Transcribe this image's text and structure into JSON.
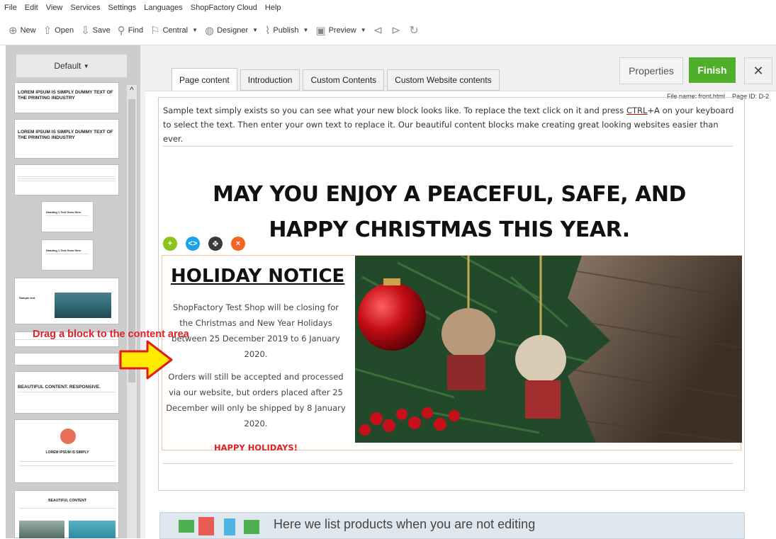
{
  "menubar": {
    "items": [
      "File",
      "Edit",
      "View",
      "Services",
      "Settings",
      "Languages",
      "ShopFactory Cloud",
      "Help"
    ]
  },
  "toolbar": {
    "new": "New",
    "open": "Open",
    "save": "Save",
    "find": "Find",
    "central": "Central",
    "designer": "Designer",
    "publish": "Publish",
    "preview": "Preview"
  },
  "leftpanel": {
    "default_label": "Default",
    "thumb1": "LOREM IPSUM IS SIMPLY DUMMY TEXT OF THE PRINTING INDUSTRY",
    "thumb2": "LOREM IPSUM IS SIMPLY DUMMY TEXT OF THE PRINTING INDUSTRY",
    "thumb3": "Heading 1 Text Goes Here",
    "thumb4": "Heading 1 Text Goes Here",
    "thumb5": "Sample text",
    "thumb6": "BEAUTIFUL CONTENT. RESPONSIVE.",
    "thumb7": "LOREM IPSUM IS SIMPLY",
    "thumb8": "BEAUTIFUL CONTENT"
  },
  "tabs": [
    "Page content",
    "Introduction",
    "Custom Contents",
    "Custom Website contents"
  ],
  "buttons": {
    "properties": "Properties",
    "finish": "Finish",
    "close": "✕"
  },
  "fileinfo": {
    "filename": "File name: front.html",
    "pageid": "Page ID: D-2"
  },
  "content": {
    "sample_before": "Sample text simply exists so you can see what your new block looks like. To replace the text click on it and press ",
    "sample_ctrl": "CTRL",
    "sample_after": "+A on your keyboard to select the text. Then enter your own text to replace it. Our beautiful content blocks make creating great looking websites easier than ever.",
    "headline_line1": "MAY YOU ENJOY A PEACEFUL, SAFE, AND",
    "headline_line2": "HAPPY CHRISTMAS THIS YEAR.",
    "holiday_title": "HOLIDAY NOTICE",
    "holiday_p1": "ShopFactory Test Shop will be closing for the Christmas and New Year Holidays between 25 December 2019 to 6 January 2020.",
    "holiday_p2": "Orders will still be accepted and processed via our website, but orders placed after 25 December will only be shipped by 8 January 2020.",
    "holiday_happy": "HAPPY HOLIDAYS!"
  },
  "block_controls": {
    "add": "+",
    "code": "<>",
    "move": "✥",
    "delete": "×"
  },
  "products_text": "Here we list products when you are not editing",
  "drag_hint": "Drag a block to the content area",
  "colors": {
    "finish": "#4fae2a",
    "drag": "#e0202a",
    "happy": "#e02020",
    "add": "#8dc21f",
    "code": "#1aa3e8",
    "move": "#3a3a3a",
    "delete": "#f26522"
  }
}
